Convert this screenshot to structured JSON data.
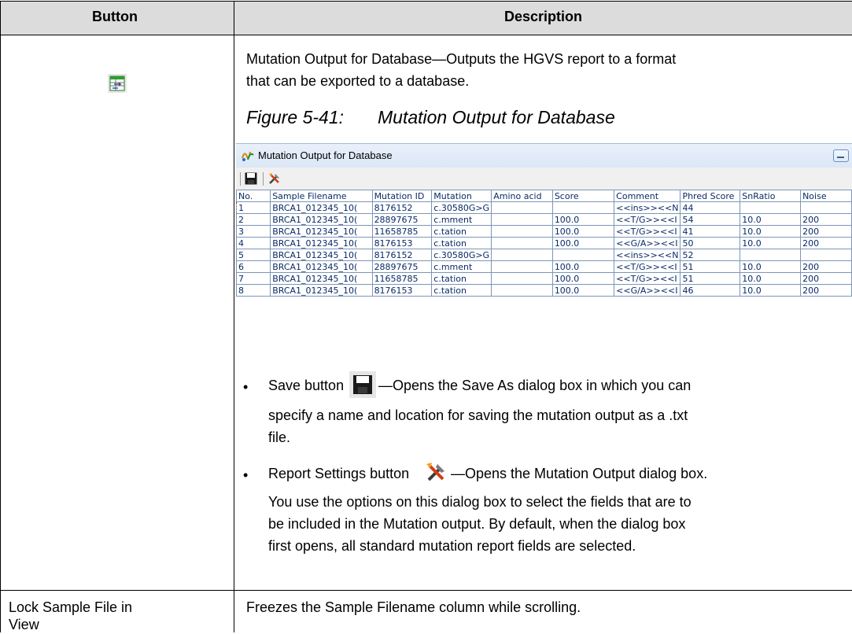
{
  "table": {
    "headers": {
      "button": "Button",
      "description": "Description"
    },
    "row1": {
      "intro": [
        "Mutation Output for Database—Outputs the HGVS report to a format",
        "that can be exported to a database."
      ],
      "figure_caption_num": "Figure 5-41:",
      "figure_caption_title": "Mutation Output for Database",
      "save_bullet": {
        "before": "Save button",
        "after": "—Opens the Save As dialog box in which you can",
        "lines": [
          "specify a name and location for saving the mutation output as a .txt",
          "file."
        ]
      },
      "settings_bullet": {
        "before": "Report Settings button",
        "after": "—Opens the Mutation Output dialog box.",
        "lines": [
          "You use the options on this dialog box to select the fields that are to",
          "be included in the Mutation output. By default, when the dialog box",
          "first opens, all standard mutation report fields are selected."
        ]
      }
    },
    "row2": {
      "button_lines": [
        "Lock Sample File in",
        "View"
      ],
      "description": "Freezes the Sample Filename column while scrolling."
    }
  },
  "window": {
    "title": "Mutation Output for Database",
    "columns": [
      "No.",
      "Sample Filename",
      "Mutation ID",
      "Mutation",
      "Amino acid",
      "Score",
      "Comment",
      "Phred Score",
      "SnRatio",
      "Noise"
    ],
    "rows": [
      [
        "1",
        "BRCA1_012345_10(",
        "8176152",
        "c.30580G>G",
        "",
        "",
        "<<ins>><<N",
        "44",
        "",
        ""
      ],
      [
        "2",
        "BRCA1_012345_10(",
        "28897675",
        "c.mment",
        "",
        "100.0",
        "<<T/G>><<I",
        "54",
        "10.0",
        "200"
      ],
      [
        "3",
        "BRCA1_012345_10(",
        "11658785",
        "c.tation",
        "",
        "100.0",
        "<<T/G>><<I",
        "41",
        "10.0",
        "200"
      ],
      [
        "4",
        "BRCA1_012345_10(",
        "8176153",
        "c.tation",
        "",
        "100.0",
        "<<G/A>><<I",
        "50",
        "10.0",
        "200"
      ],
      [
        "5",
        "BRCA1_012345_10(",
        "8176152",
        "c.30580G>G",
        "",
        "",
        "<<ins>><<N",
        "52",
        "",
        ""
      ],
      [
        "6",
        "BRCA1_012345_10(",
        "28897675",
        "c.mment",
        "",
        "100.0",
        "<<T/G>><<I",
        "51",
        "10.0",
        "200"
      ],
      [
        "7",
        "BRCA1_012345_10(",
        "11658785",
        "c.tation",
        "",
        "100.0",
        "<<T/G>><<I",
        "51",
        "10.0",
        "200"
      ],
      [
        "8",
        "BRCA1_012345_10(",
        "8176153",
        "c.tation",
        "",
        "100.0",
        "<<G/A>><<I",
        "46",
        "10.0",
        "200"
      ]
    ]
  },
  "bullet_char": "•"
}
